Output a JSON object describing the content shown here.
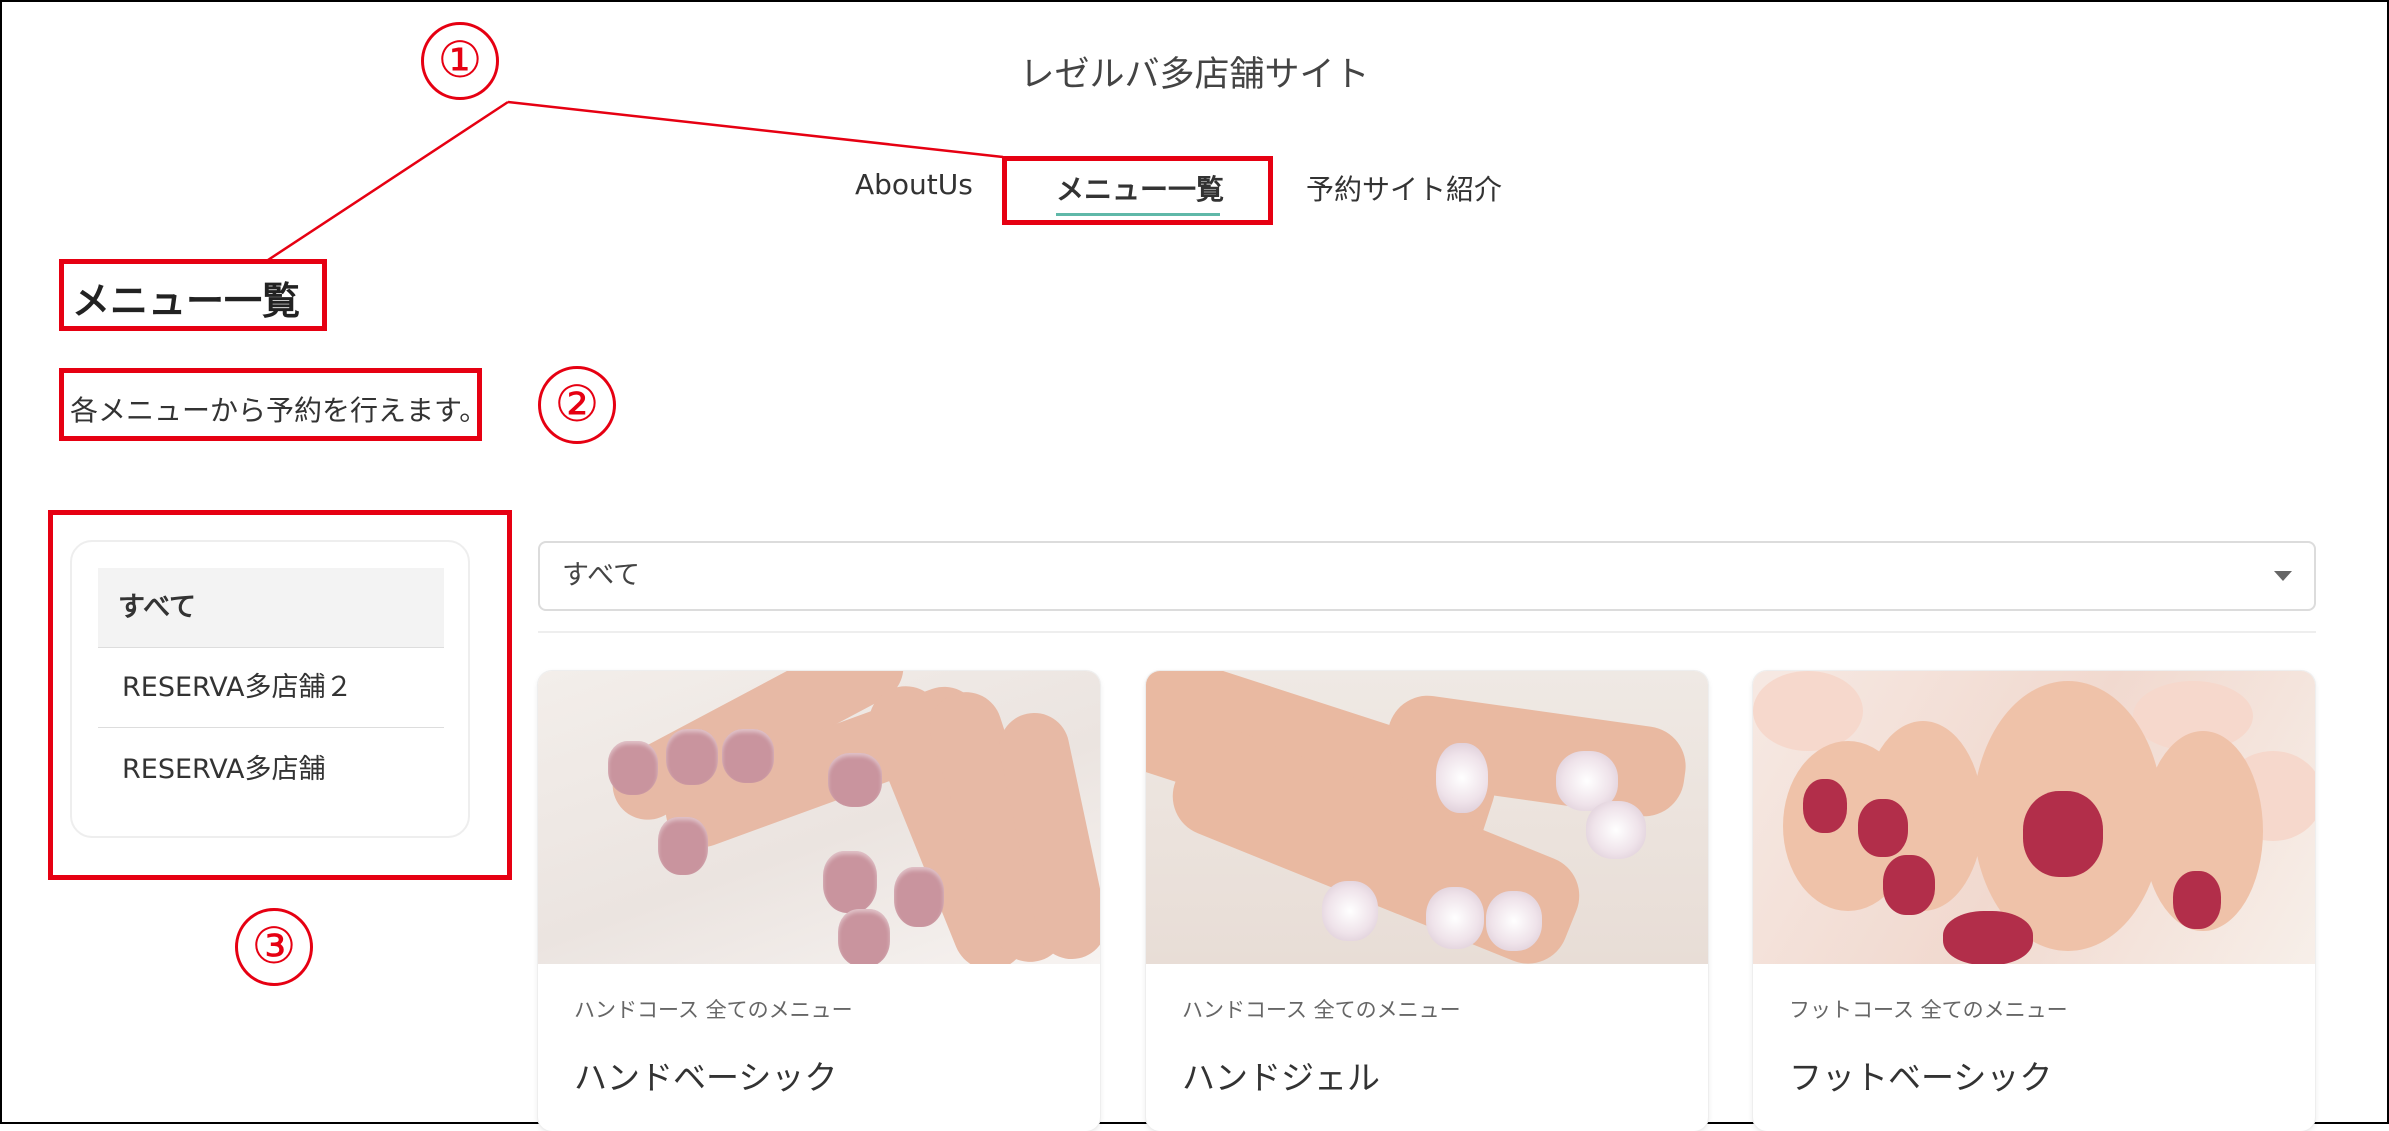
{
  "site": {
    "title": "レゼルバ多店舗サイト"
  },
  "nav": {
    "items": [
      {
        "label": "AboutUs"
      },
      {
        "label": "メニュー一覧"
      },
      {
        "label": "予約サイト紹介"
      }
    ],
    "active_index": 1
  },
  "page": {
    "heading": "メニュー一覧",
    "description": "各メニューから予約を行えます。"
  },
  "sidebar": {
    "items": [
      {
        "label": "すべて"
      },
      {
        "label": "RESERVA多店舗２"
      },
      {
        "label": "RESERVA多店舗"
      }
    ],
    "active_index": 0
  },
  "filter": {
    "selected": "すべて"
  },
  "cards": [
    {
      "tags": "ハンドコース 全てのメニュー",
      "title": "ハンドベーシック",
      "image": "pink-manicure-photo"
    },
    {
      "tags": "ハンドコース 全てのメニュー",
      "title": "ハンドジェル",
      "image": "glitter-gel-nails-photo"
    },
    {
      "tags": "フットコース 全てのメニュー",
      "title": "フットベーシック",
      "image": "red-pedicure-photo"
    }
  ],
  "annotations": {
    "markers": [
      "①",
      "②",
      "③"
    ],
    "color": "#e60012"
  },
  "colors": {
    "accent": "#5fb8a8"
  }
}
